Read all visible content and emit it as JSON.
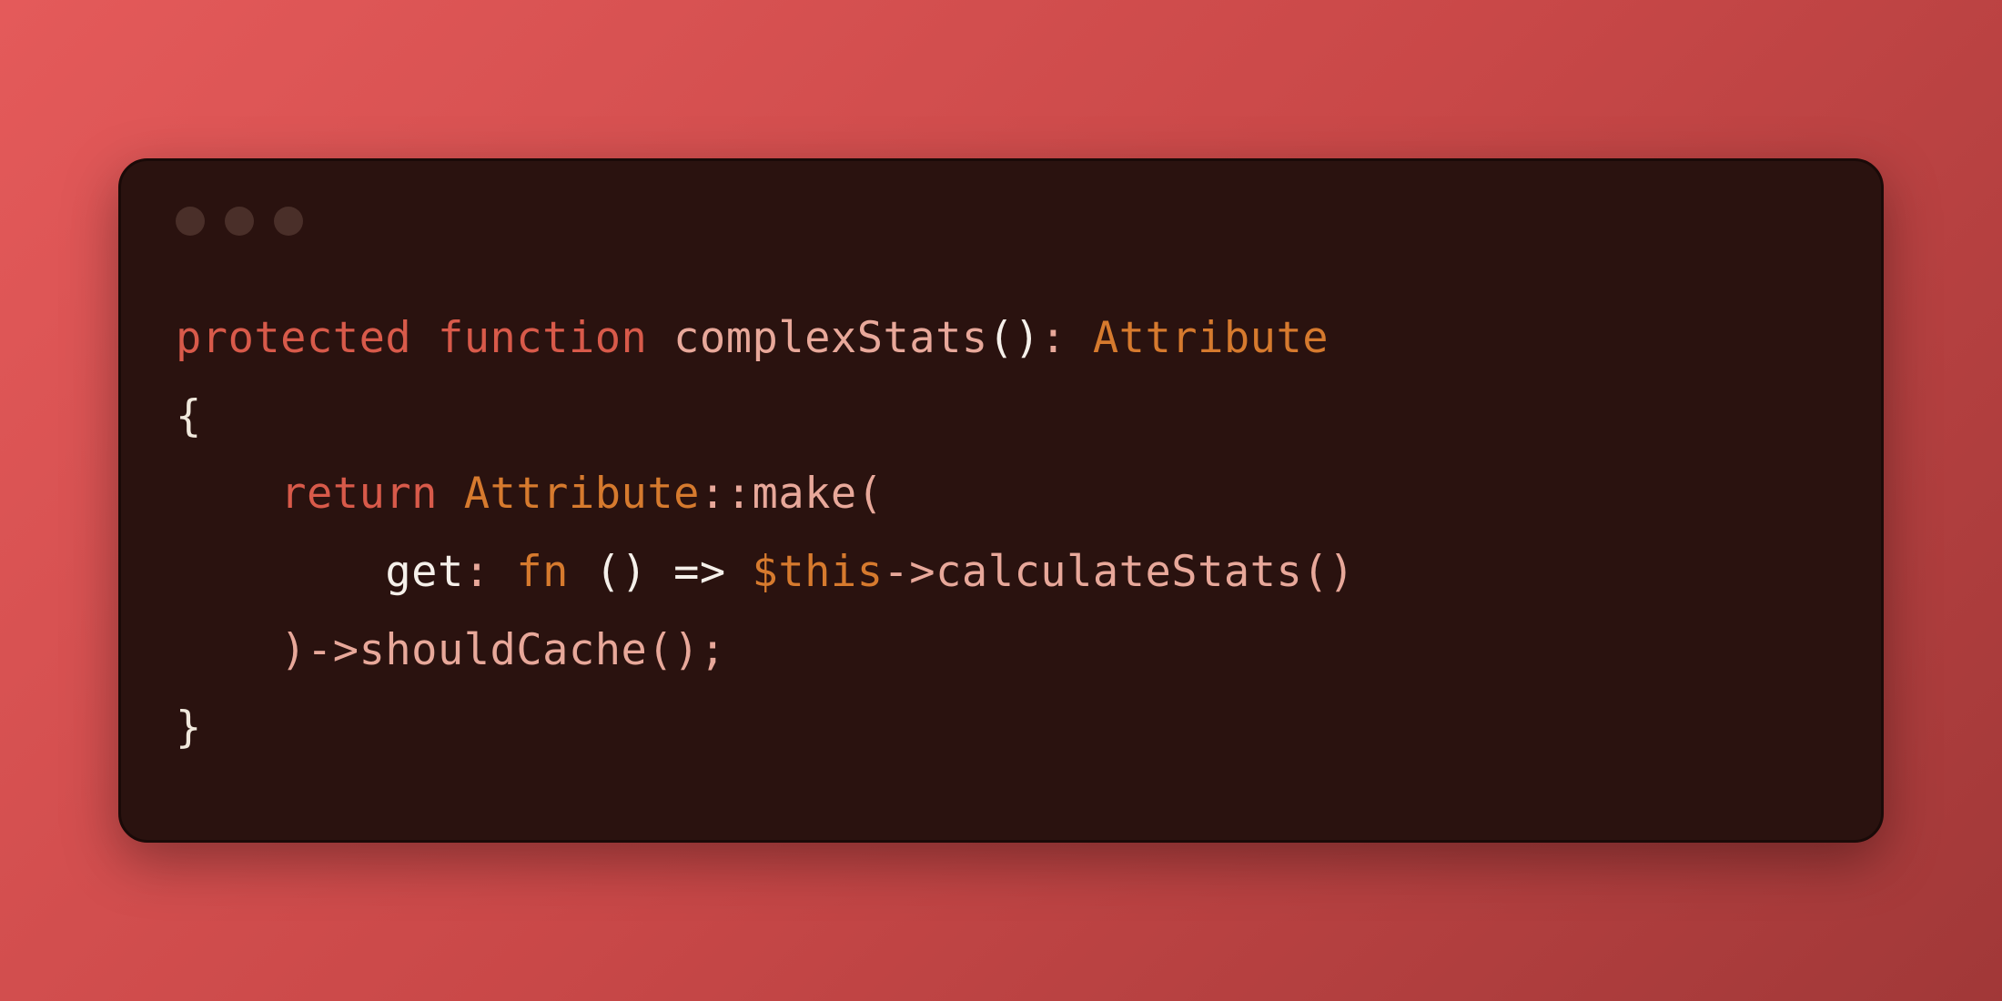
{
  "code": {
    "l1": {
      "protected": "protected",
      "function": "function",
      "space": " ",
      "name": "complexStats",
      "parens": "()",
      "colon": ": ",
      "ret": "Attribute"
    },
    "l2": {
      "brace": "{"
    },
    "l3": {
      "indent": "    ",
      "return": "return",
      "space": " ",
      "cls": "Attribute",
      "scope": "::",
      "make": "make",
      "open": "("
    },
    "l4": {
      "indent": "        ",
      "get": "get",
      "colon": ":",
      "space": " ",
      "fn": "fn",
      "parens": " () ",
      "arrow": "=>",
      "sp2": " ",
      "this": "$this",
      "arr2": "->",
      "calc": "calculateStats",
      "parens2": "()"
    },
    "l5": {
      "indent": "    ",
      "close": ")",
      "arrow": "->",
      "should": "shouldCache",
      "parens": "()",
      "semi": ";"
    },
    "l6": {
      "brace": "}"
    }
  }
}
